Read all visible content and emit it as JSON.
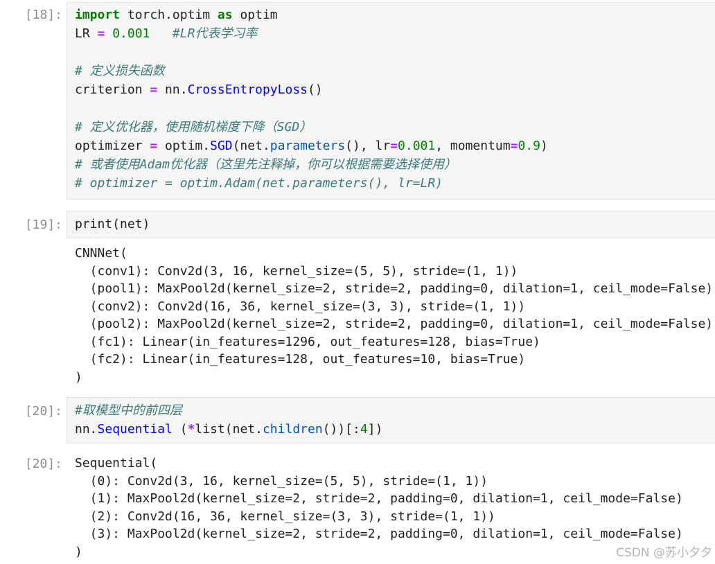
{
  "cells": [
    {
      "prompt": "[18]:",
      "code_lines": [
        [
          [
            "kw",
            "import"
          ],
          [
            "pl",
            " torch.optim "
          ],
          [
            "kw",
            "as"
          ],
          [
            "pl",
            " optim"
          ]
        ],
        [
          [
            "pl",
            "LR "
          ],
          [
            "op",
            "="
          ],
          [
            "pl",
            " "
          ],
          [
            "num",
            "0.001"
          ],
          [
            "pl",
            "   "
          ],
          [
            "cm",
            "#LR代表学习率"
          ]
        ],
        [],
        [
          [
            "cm",
            "# 定义损失函数"
          ]
        ],
        [
          [
            "pl",
            "criterion "
          ],
          [
            "op",
            "="
          ],
          [
            "pl",
            " nn."
          ],
          [
            "fn",
            "CrossEntropyLoss"
          ],
          [
            "pl",
            "()"
          ]
        ],
        [],
        [
          [
            "cm",
            "# 定义优化器，使用随机梯度下降（SGD）"
          ]
        ],
        [
          [
            "pl",
            "optimizer "
          ],
          [
            "op",
            "="
          ],
          [
            "pl",
            " optim."
          ],
          [
            "fn",
            "SGD"
          ],
          [
            "pl",
            "(net."
          ],
          [
            "mth",
            "parameters"
          ],
          [
            "pl",
            "(), lr"
          ],
          [
            "op",
            "="
          ],
          [
            "num",
            "0.001"
          ],
          [
            "pl",
            ", momentum"
          ],
          [
            "op",
            "="
          ],
          [
            "num",
            "0.9"
          ],
          [
            "pl",
            ")"
          ]
        ],
        [
          [
            "cm",
            "# 或者使用Adam优化器（这里先注释掉，你可以根据需要选择使用）"
          ]
        ],
        [
          [
            "cm",
            "# optimizer = optim.Adam(net.parameters(), lr=LR)"
          ]
        ]
      ]
    },
    {
      "prompt": "[19]:",
      "code_lines": [
        [
          [
            "pl",
            "print(net)"
          ]
        ]
      ],
      "output_lines": [
        "CNNNet(",
        "  (conv1): Conv2d(3, 16, kernel_size=(5, 5), stride=(1, 1))",
        "  (pool1): MaxPool2d(kernel_size=2, stride=2, padding=0, dilation=1, ceil_mode=False)",
        "  (conv2): Conv2d(16, 36, kernel_size=(3, 3), stride=(1, 1))",
        "  (pool2): MaxPool2d(kernel_size=2, stride=2, padding=0, dilation=1, ceil_mode=False)",
        "  (fc1): Linear(in_features=1296, out_features=128, bias=True)",
        "  (fc2): Linear(in_features=128, out_features=10, bias=True)",
        ")"
      ]
    },
    {
      "prompt": "[20]:",
      "code_lines": [
        [
          [
            "cm",
            "#取模型中的前四层"
          ]
        ],
        [
          [
            "pl",
            "nn."
          ],
          [
            "fn",
            "Sequential"
          ],
          [
            "pl",
            " ("
          ],
          [
            "op",
            "*"
          ],
          [
            "pl",
            "list(net."
          ],
          [
            "mth",
            "children"
          ],
          [
            "pl",
            "())"
          ],
          [
            "hl",
            "[:"
          ],
          [
            "num",
            "4"
          ],
          [
            "hl",
            "]"
          ],
          [
            "pl",
            ")"
          ]
        ]
      ],
      "output_prompt": "[20]:",
      "output_lines": [
        "Sequential(",
        "  (0): Conv2d(3, 16, kernel_size=(5, 5), stride=(1, 1))",
        "  (1): MaxPool2d(kernel_size=2, stride=2, padding=0, dilation=1, ceil_mode=False)",
        "  (2): Conv2d(16, 36, kernel_size=(3, 3), stride=(1, 1))",
        "  (3): MaxPool2d(kernel_size=2, stride=2, padding=0, dilation=1, ceil_mode=False)",
        ")"
      ]
    }
  ],
  "watermark": "CSDN @苏小夕夕"
}
